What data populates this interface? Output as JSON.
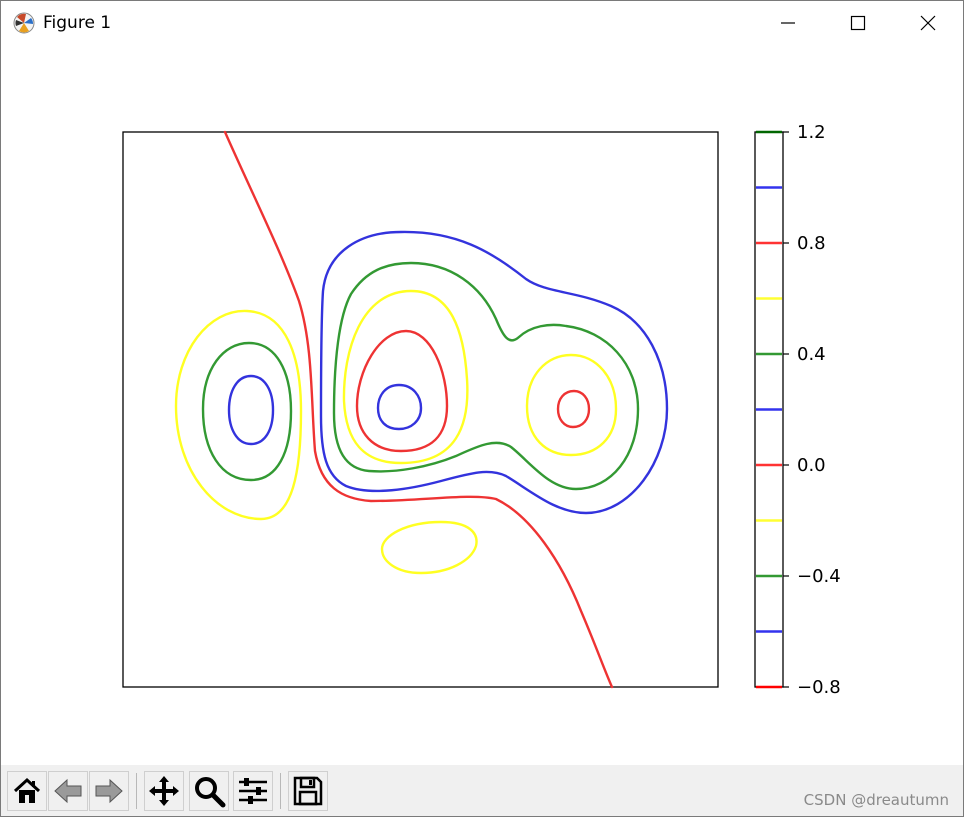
{
  "window": {
    "title": "Figure 1"
  },
  "toolbar": {
    "buttons": [
      {
        "name": "home-button",
        "icon": "home-icon"
      },
      {
        "name": "back-button",
        "icon": "arrow-left-icon"
      },
      {
        "name": "forward-button",
        "icon": "arrow-right-icon"
      },
      {
        "name": "pan-button",
        "icon": "move-icon"
      },
      {
        "name": "zoom-button",
        "icon": "magnifier-icon"
      },
      {
        "name": "configure-subplots-button",
        "icon": "sliders-icon"
      },
      {
        "name": "save-button",
        "icon": "floppy-disk-icon"
      }
    ],
    "watermark": "CSDN @dreautumn"
  },
  "chart_data": {
    "type": "contour",
    "colorbar": {
      "range": [
        -0.8,
        1.2
      ],
      "levels": [
        -0.8,
        -0.6,
        -0.4,
        -0.2,
        0.0,
        0.2,
        0.4,
        0.6,
        0.8,
        1.0,
        1.2
      ],
      "level_colors": [
        "#ff0000",
        "#3333ee",
        "#339933",
        "#ffff33",
        "#ff3333",
        "#3333ee",
        "#339933",
        "#ffff33",
        "#ff3333",
        "#3333ee",
        "#006600"
      ],
      "tick_labels": [
        "1.2",
        "0.8",
        "0.4",
        "0.0",
        "−0.4",
        "−0.8"
      ],
      "tick_values": [
        1.2,
        0.8,
        0.4,
        0.0,
        -0.4,
        -0.8
      ]
    },
    "line_colors": {
      "red": "#ee3333",
      "yellow": "#ffff22",
      "green": "#339933",
      "blue": "#3333dd"
    },
    "axes_ticks_visible": false
  }
}
